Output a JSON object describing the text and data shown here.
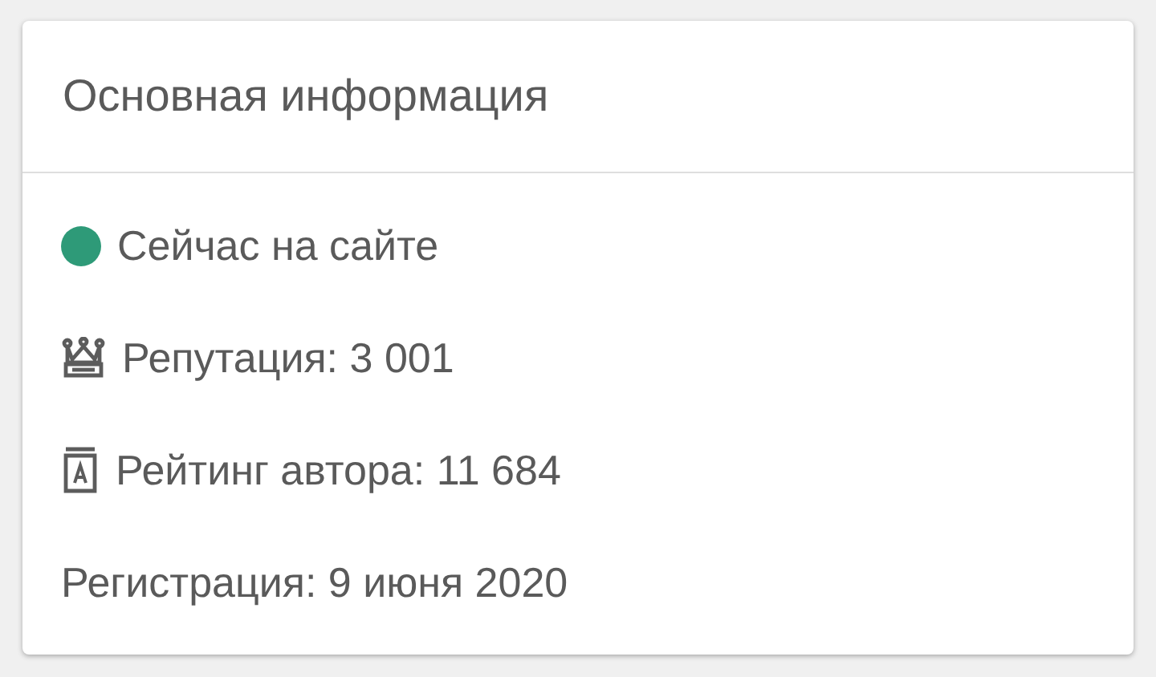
{
  "card": {
    "title": "Основная информация",
    "rows": [
      {
        "kind": "status",
        "text": "Сейчас на сайте",
        "color": "#2e9a78"
      },
      {
        "kind": "reputation",
        "text": "Репутация: 3 001"
      },
      {
        "kind": "rating",
        "text": "Рейтинг автора: 11 684"
      },
      {
        "kind": "plain",
        "text": "Регистрация: 9 июня 2020"
      }
    ]
  }
}
